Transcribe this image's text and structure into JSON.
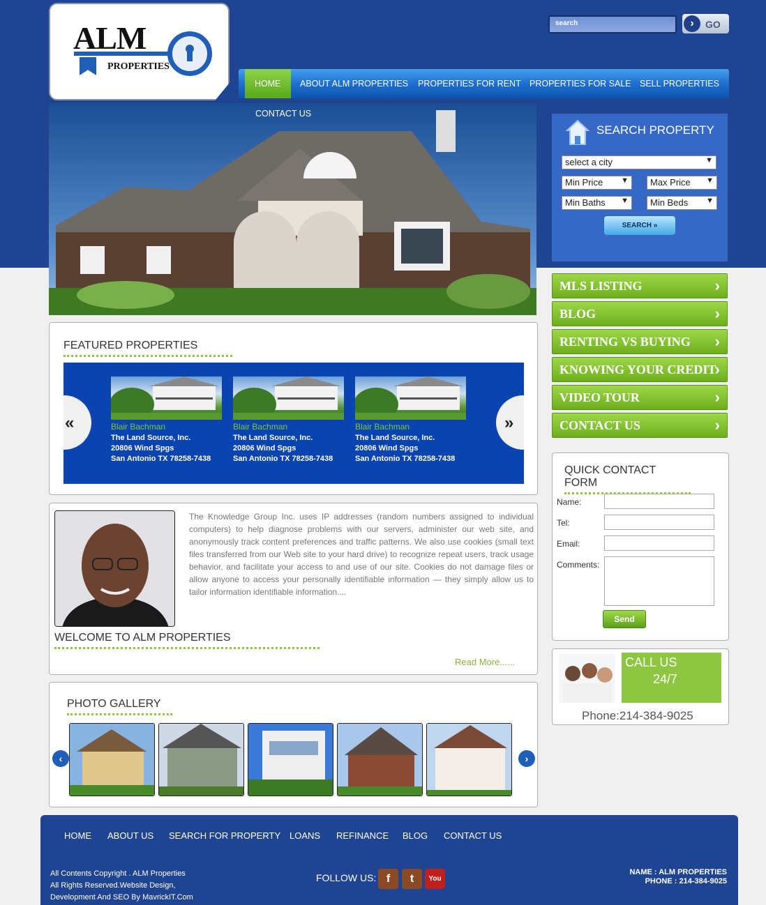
{
  "logo": {
    "alm": "ALM",
    "properties": "PROPERTIES"
  },
  "top_search": {
    "placeholder": "search",
    "go_label": "GO"
  },
  "nav": {
    "items": [
      "HOME",
      "ABOUT ALM PROPERTIES",
      "PROPERTIES FOR RENT",
      "PROPERTIES FOR SALE",
      "SELL PROPERTIES",
      "CONTACT US"
    ],
    "active": "HOME"
  },
  "search_property": {
    "title": "SEARCH PROPERTY",
    "city": "select a city",
    "min_price": "Min Price",
    "max_price": "Max Price",
    "min_baths": "Min Baths",
    "min_beds": "Min Beds",
    "button": "SEARCH"
  },
  "side_menu": [
    "MLS LISTING",
    "BLOG",
    "RENTING VS BUYING",
    "KNOWING YOUR CREDIT",
    "VIDEO TOUR",
    "CONTACT US"
  ],
  "featured": {
    "title": "FEATURED PROPERTIES",
    "cards": [
      {
        "name": "Blair Bachman",
        "company": "The Land Source, Inc.",
        "street": "20806 Wind Spgs",
        "city": "San Antonio TX 78258-7438"
      },
      {
        "name": "Blair Bachman",
        "company": "The Land Source, Inc.",
        "street": "20806 Wind Spgs",
        "city": "San Antonio TX 78258-7438"
      },
      {
        "name": "Blair Bachman",
        "company": "The Land Source, Inc.",
        "street": "20806 Wind Spgs",
        "city": "San Antonio TX 78258-7438"
      }
    ]
  },
  "welcome": {
    "title": "WELCOME TO ALM PROPERTIES",
    "text": "The Knowledge Group Inc. uses IP addresses (random numbers assigned to individual computers) to help diagnose problems with our servers, administer our web site, and anonymously track content preferences and traffic patterns. We also use cookies (small text files transferred from our Web site to your hard drive) to recognize repeat users, track usage behavior, and facilitate your access to and use of our site. Cookies do not damage files or allow anyone to access your personally identifiable information — they simply allow us to tailor information identifiable information....",
    "read_more": "Read More......"
  },
  "gallery": {
    "title": "PHOTO GALLERY"
  },
  "quick_contact": {
    "title": "QUICK CONTACT FORM",
    "name_label": "Name:",
    "tel_label": "Tel:",
    "email_label": "Email:",
    "comments_label": "Comments:",
    "send": "Send"
  },
  "call": {
    "line1": "CALL US",
    "line2": "24/7",
    "phone": "Phone:214-384-9025"
  },
  "footer": {
    "nav": [
      "HOME",
      "ABOUT US",
      "SEARCH FOR PROPERTY",
      "LOANS",
      "REFINANCE",
      "BLOG",
      "CONTACT US"
    ],
    "copy1": "All Contents Copyright . ALM Properties",
    "copy2": "All Rights Reserved.Website Design,",
    "copy3": "Development And SEO By MavrickIT.Com",
    "follow": "FOLLOW US:",
    "name": "NAME : ALM PROPERTIES",
    "phone": "PHONE : 214-384-9025"
  },
  "colors": {
    "brand_blue": "#1f4592",
    "accent_green": "#8dc63f",
    "nav_blue": "#1f6fd0"
  }
}
